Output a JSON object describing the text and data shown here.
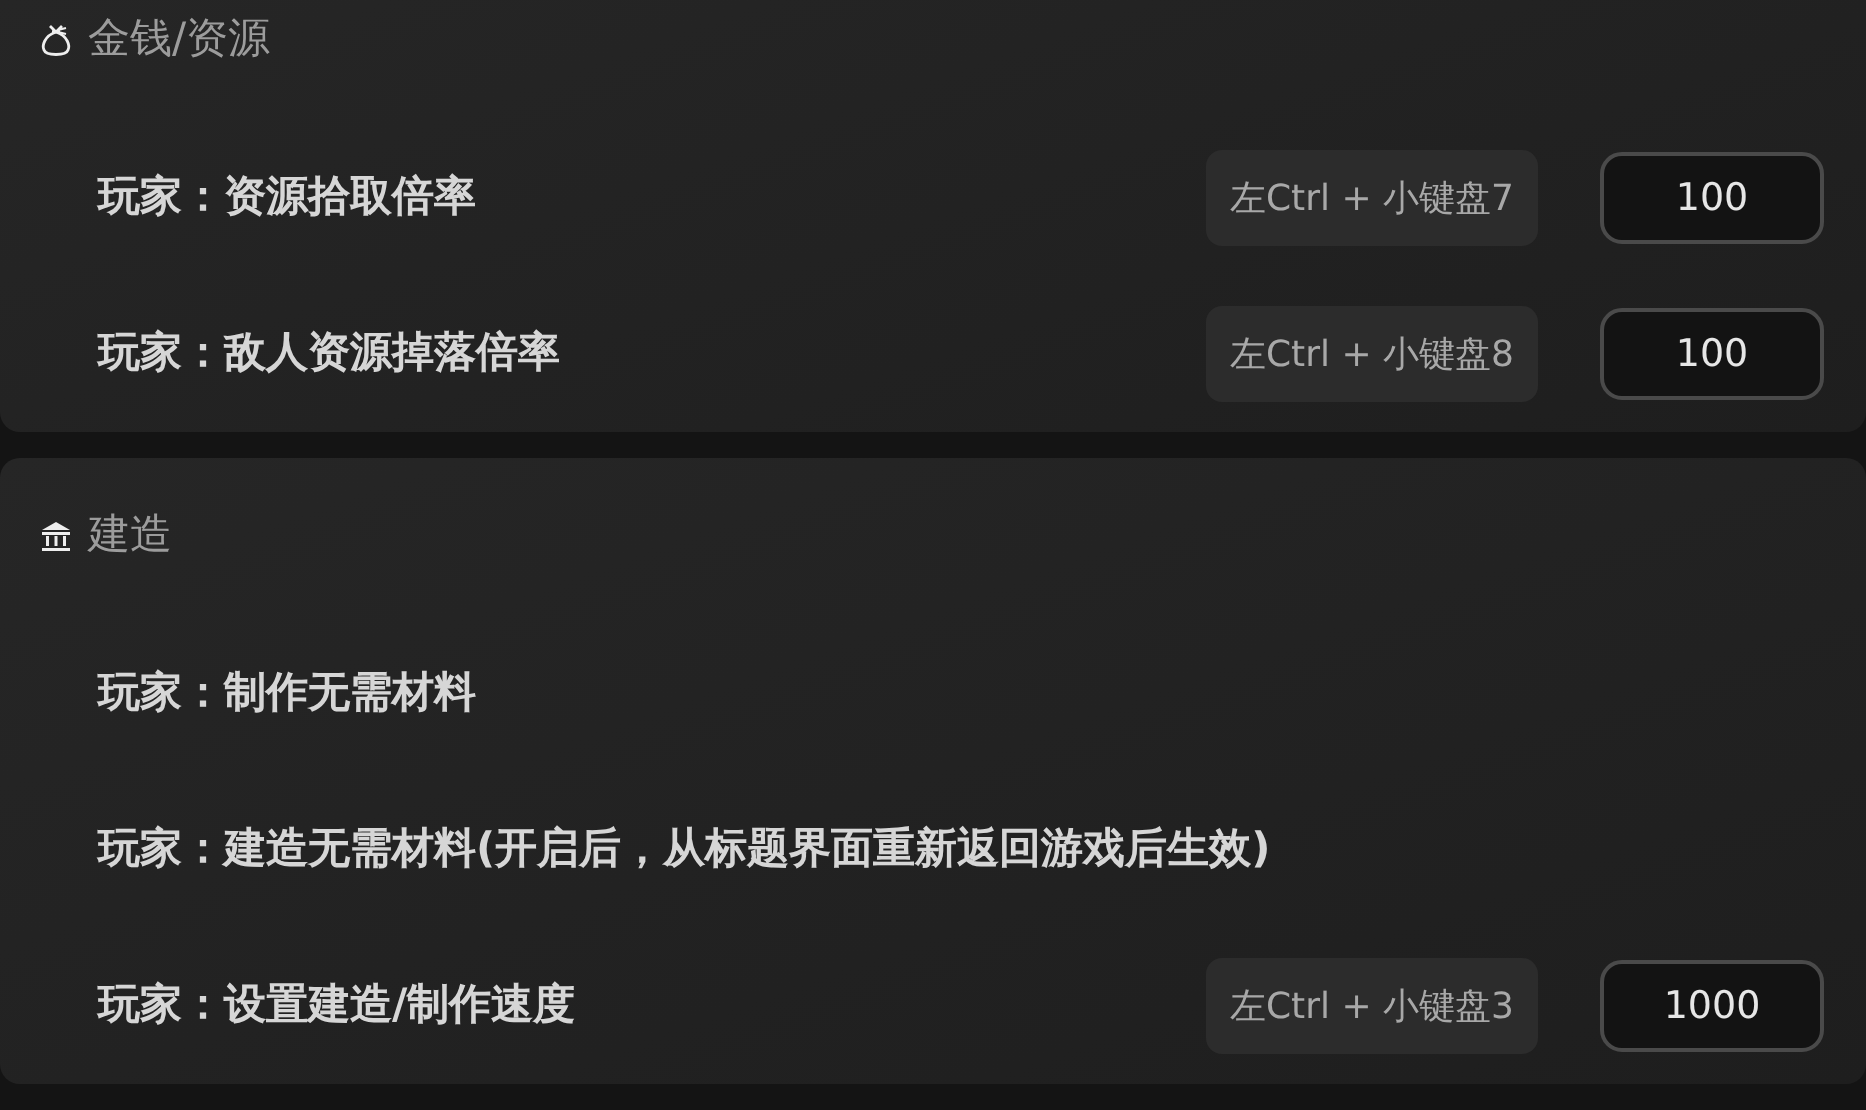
{
  "sections": [
    {
      "title": "金钱/资源",
      "rows": [
        {
          "label": "玩家：资源拾取倍率",
          "hotkey": "左Ctrl + 小键盘7",
          "value": "100"
        },
        {
          "label": "玩家：敌人资源掉落倍率",
          "hotkey": "左Ctrl + 小键盘8",
          "value": "100"
        }
      ]
    },
    {
      "title": "建造",
      "rows": [
        {
          "label": "玩家：制作无需材料"
        },
        {
          "label": "玩家：建造无需材料(开启后，从标题界面重新返回游戏后生效)"
        },
        {
          "label": "玩家：设置建造/制作速度",
          "hotkey": "左Ctrl + 小键盘3",
          "value": "1000"
        }
      ]
    }
  ]
}
